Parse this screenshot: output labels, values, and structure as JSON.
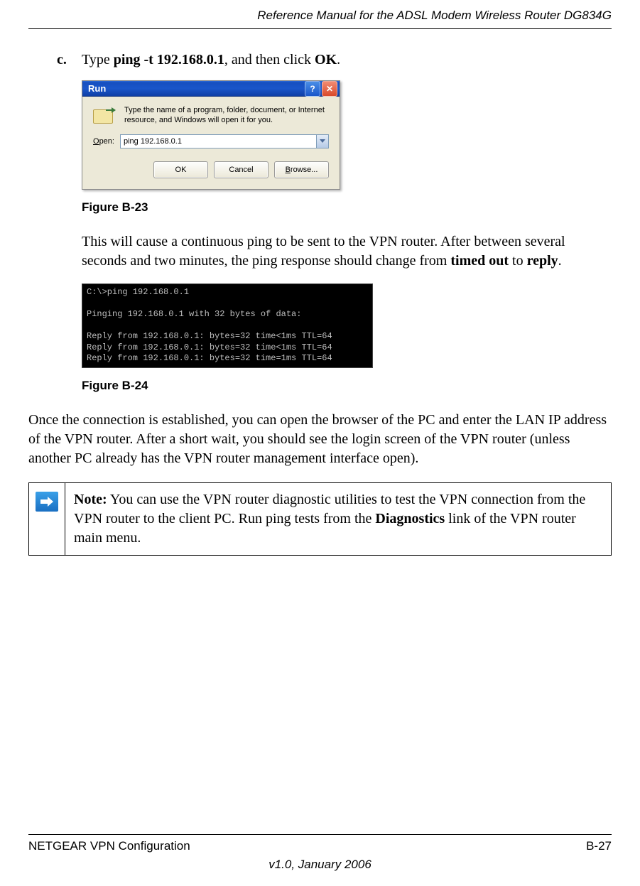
{
  "header": {
    "title": "Reference Manual for the ADSL Modem Wireless Router DG834G"
  },
  "step_c": {
    "marker": "c.",
    "pre": "Type  ",
    "cmd": "ping -t 192.168.0.1",
    "mid": ", and then click ",
    "ok": "OK",
    "end": "."
  },
  "run_dialog": {
    "title": "Run",
    "desc": "Type the name of a program, folder, document, or Internet resource, and Windows will open it for you.",
    "open_label_u": "O",
    "open_label_rest": "pen:",
    "input_value": "ping 192.168.0.1",
    "btn_ok": "OK",
    "btn_cancel": "Cancel",
    "btn_browse_u": "B",
    "btn_browse_rest": "rowse..."
  },
  "fig23": "Figure B-23",
  "para1": {
    "pre": "This will cause a continuous ping to be sent to the VPN router. After between several seconds and two minutes, the ping response should change from ",
    "b1": "timed out",
    "mid": " to ",
    "b2": "reply",
    "end": "."
  },
  "terminal": "C:\\>ping 192.168.0.1\n\nPinging 192.168.0.1 with 32 bytes of data:\n\nReply from 192.168.0.1: bytes=32 time<1ms TTL=64\nReply from 192.168.0.1: bytes=32 time<1ms TTL=64\nReply from 192.168.0.1: bytes=32 time=1ms TTL=64",
  "fig24": "Figure B-24",
  "para2": "Once the connection is established, you can open the browser of the PC and enter the LAN IP address of the VPN router. After a short wait, you should see the login screen of the VPN router (unless another PC already has the VPN router management interface open).",
  "note": {
    "label": "Note:",
    "pre": " You can use the VPN router diagnostic utilities to test the VPN connection from the VPN router to the client PC. Run ping tests from the ",
    "b": "Diagnostics",
    "end": " link of the VPN router main menu."
  },
  "footer": {
    "left": "NETGEAR VPN Configuration",
    "right": "B-27",
    "version": "v1.0, January 2006"
  }
}
